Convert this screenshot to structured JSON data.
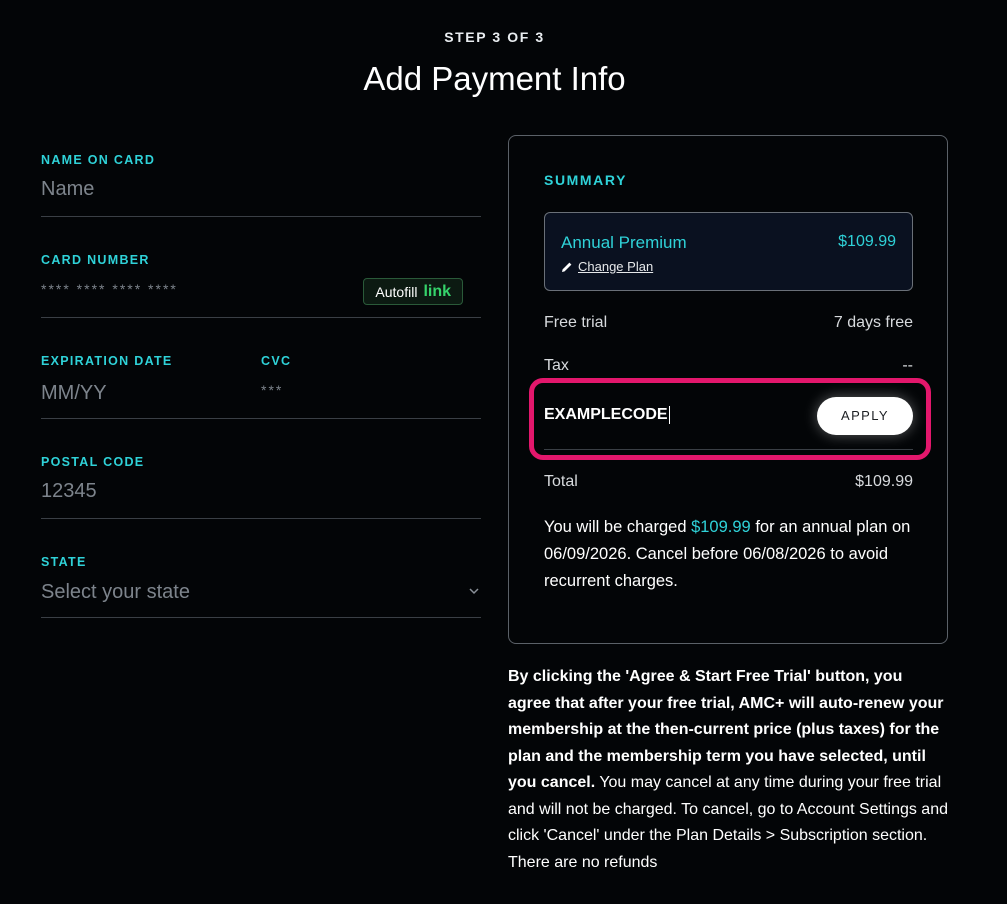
{
  "header": {
    "step": "STEP 3 OF 3",
    "title": "Add Payment Info"
  },
  "form": {
    "name": {
      "label": "NAME ON CARD",
      "placeholder": "Name"
    },
    "card": {
      "label": "CARD NUMBER",
      "placeholder": "**** **** **** ****",
      "autofill_text": "Autofill",
      "autofill_brand": "link"
    },
    "expiration": {
      "label": "EXPIRATION DATE",
      "placeholder": "MM/YY"
    },
    "cvc": {
      "label": "CVC",
      "placeholder": "***"
    },
    "postal": {
      "label": "POSTAL CODE",
      "placeholder": "12345"
    },
    "state": {
      "label": "STATE",
      "placeholder": "Select your state"
    }
  },
  "summary": {
    "label": "SUMMARY",
    "plan_name": "Annual Premium",
    "plan_price": "$109.99",
    "change_plan": "Change Plan",
    "free_trial_label": "Free trial",
    "free_trial_value": "7 days free",
    "tax_label": "Tax",
    "tax_value": "--",
    "promo_code": "EXAMPLECODE",
    "apply_label": "APPLY",
    "total_label": "Total",
    "total_value": "$109.99",
    "charge_pre": "You will be charged ",
    "charge_amount": "$109.99",
    "charge_post": " for an annual plan on 06/09/2026. Cancel before 06/08/2026 to avoid recurrent charges."
  },
  "legal": {
    "bold": "By clicking the 'Agree & Start Free Trial' button, you agree that after your free trial, AMC+ will auto-renew your membership at the then-current price (plus taxes) for the plan and the membership term you have selected, until you cancel.",
    "rest": " You may cancel at any time during your free trial and will not be charged. To cancel, go to Account Settings and click 'Cancel' under the Plan Details > Subscription section. There are no refunds"
  },
  "colors": {
    "accent": "#2fd2d8",
    "highlight": "#e3176c",
    "link_green": "#35d36b"
  }
}
